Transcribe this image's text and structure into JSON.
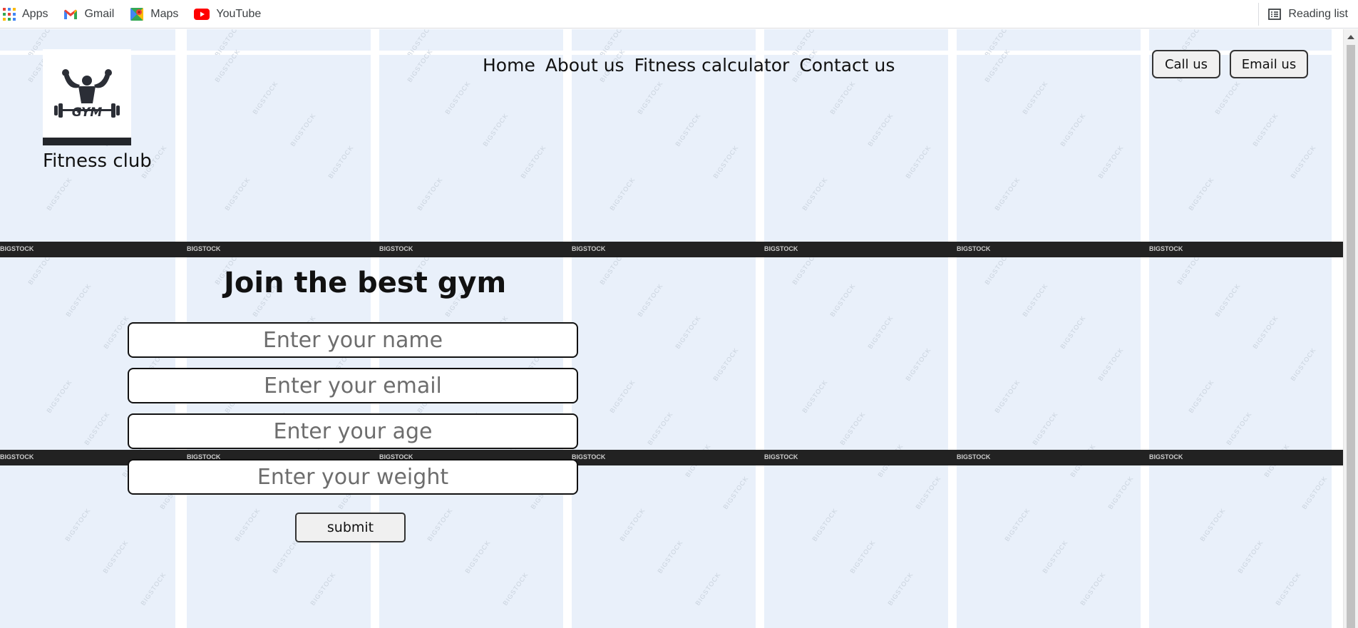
{
  "bookmarks": {
    "items": [
      {
        "label": "Apps",
        "icon": "apps-grid-icon"
      },
      {
        "label": "Gmail",
        "icon": "gmail-icon"
      },
      {
        "label": "Maps",
        "icon": "maps-icon"
      },
      {
        "label": "YouTube",
        "icon": "youtube-icon"
      }
    ],
    "reading_list": "Reading list"
  },
  "watermark": {
    "text": "BIGSTOCK",
    "strip_brand": "BIGSTOCK"
  },
  "header": {
    "logo_icon": "gym-bodybuilder-logo-icon",
    "logo_text": "GYM",
    "brand_name": "Fitness club",
    "nav": [
      "Home",
      "About us",
      "Fitness calculator",
      "Contact us"
    ],
    "call_button": "Call us",
    "email_button": "Email us"
  },
  "form": {
    "title": "Join the best gym",
    "name_placeholder": "Enter your name",
    "email_placeholder": "Enter your email",
    "age_placeholder": "Enter your age",
    "weight_placeholder": "Enter your weight",
    "submit_label": "submit"
  },
  "colors": {
    "tile_background": "#e9f0fa",
    "strip": "#222222",
    "youtube_red": "#ff0000"
  }
}
